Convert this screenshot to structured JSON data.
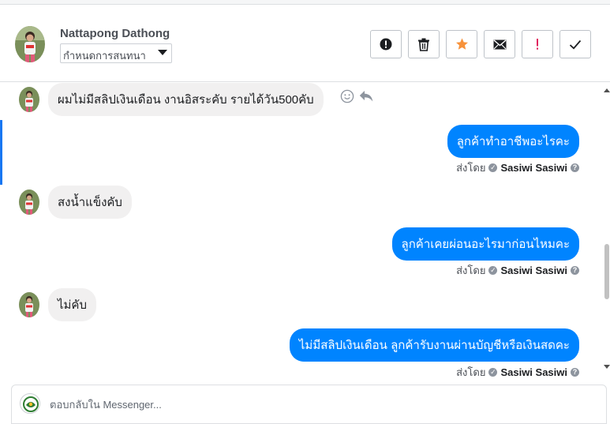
{
  "header": {
    "contact_name": "Nattapong Dathong",
    "label_dropdown": "กำหนดการสนทนา",
    "actions": [
      {
        "icon": "alert-circle-icon"
      },
      {
        "icon": "trash-icon"
      },
      {
        "icon": "star-icon"
      },
      {
        "icon": "envelope-icon"
      },
      {
        "icon": "exclamation-icon"
      },
      {
        "icon": "checkmark-icon"
      }
    ]
  },
  "messages": [
    {
      "direction": "in",
      "text": "ผมไม่มีสลิปเงินเดือน  งานอิสระคับ รายได้วัน500คับ"
    },
    {
      "direction": "out",
      "text": "ลูกค้าทำอาชีพอะไรคะ",
      "sent_by_label": "ส่งโดย",
      "sender": "Sasiwi Sasiwi"
    },
    {
      "direction": "in",
      "text": "สงน้ำแข็งคับ"
    },
    {
      "direction": "out",
      "text": "ลูกค้าเคยผ่อนอะไรมาก่อนไหมคะ",
      "sent_by_label": "ส่งโดย",
      "sender": "Sasiwi Sasiwi"
    },
    {
      "direction": "in",
      "text": "ไม่คับ"
    },
    {
      "direction": "out",
      "text": "ไม่มีสลิปเงินเดือน ลูกค้ารับงานผ่านบัญชีหรือเงินสดคะ",
      "sent_by_label": "ส่งโดย",
      "sender": "Sasiwi Sasiwi"
    }
  ],
  "composer": {
    "placeholder": "ตอบกลับใน Messenger..."
  },
  "colors": {
    "accent": "#0084ff",
    "star": "#f7923b",
    "alert": "#e0245e"
  }
}
